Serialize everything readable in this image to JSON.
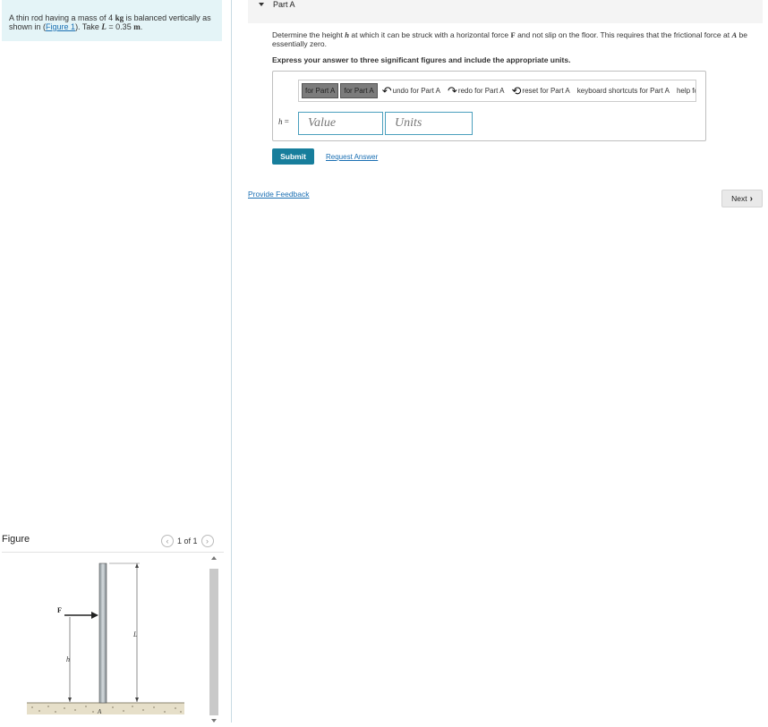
{
  "problem": {
    "text_1": "A thin rod having a mass of 4 ",
    "mass_unit": "kg",
    "text_2": " is balanced vertically as shown in (",
    "figure_link": "Figure 1",
    "text_3": "). Take ",
    "length_var": "L",
    "text_4": " = 0.35 ",
    "length_unit": "m",
    "text_5": "."
  },
  "figure": {
    "label": "Figure",
    "pager_count": "1 of 1",
    "prev_icon": "chevron-left-icon",
    "next_icon": "chevron-right-icon",
    "labels": {
      "force": "F",
      "height": "h",
      "length": "L",
      "point": "A"
    }
  },
  "part": {
    "title": "Part A",
    "question_1": "Determine the height ",
    "question_h": "h",
    "question_2": " at which it can be struck with a horizontal force ",
    "question_F": "F",
    "question_3": " and not slip on the floor. This requires that the frictional force at ",
    "question_A": "A",
    "question_4": " be essentially zero.",
    "instruction": "Express your answer to three significant figures and include the appropriate units."
  },
  "toolbar": {
    "items": [
      {
        "label": "for Part A",
        "style": "dark"
      },
      {
        "label": "for Part A",
        "style": "dark"
      },
      {
        "label": "undo for Part A",
        "glyph": "↶"
      },
      {
        "label": "redo for Part A",
        "glyph": "↷"
      },
      {
        "label": "reset for Part A",
        "glyph": "⟲"
      },
      {
        "label": "keyboard shortcuts for Part A"
      },
      {
        "label": "help for Part A"
      }
    ]
  },
  "answer": {
    "variable": "h",
    "equals": " =",
    "value_placeholder": "Value",
    "units_placeholder": "Units"
  },
  "actions": {
    "submit": "Submit",
    "request": "Request Answer",
    "feedback": "Provide Feedback",
    "next": "Next",
    "next_icon": "chevron-right-icon"
  }
}
